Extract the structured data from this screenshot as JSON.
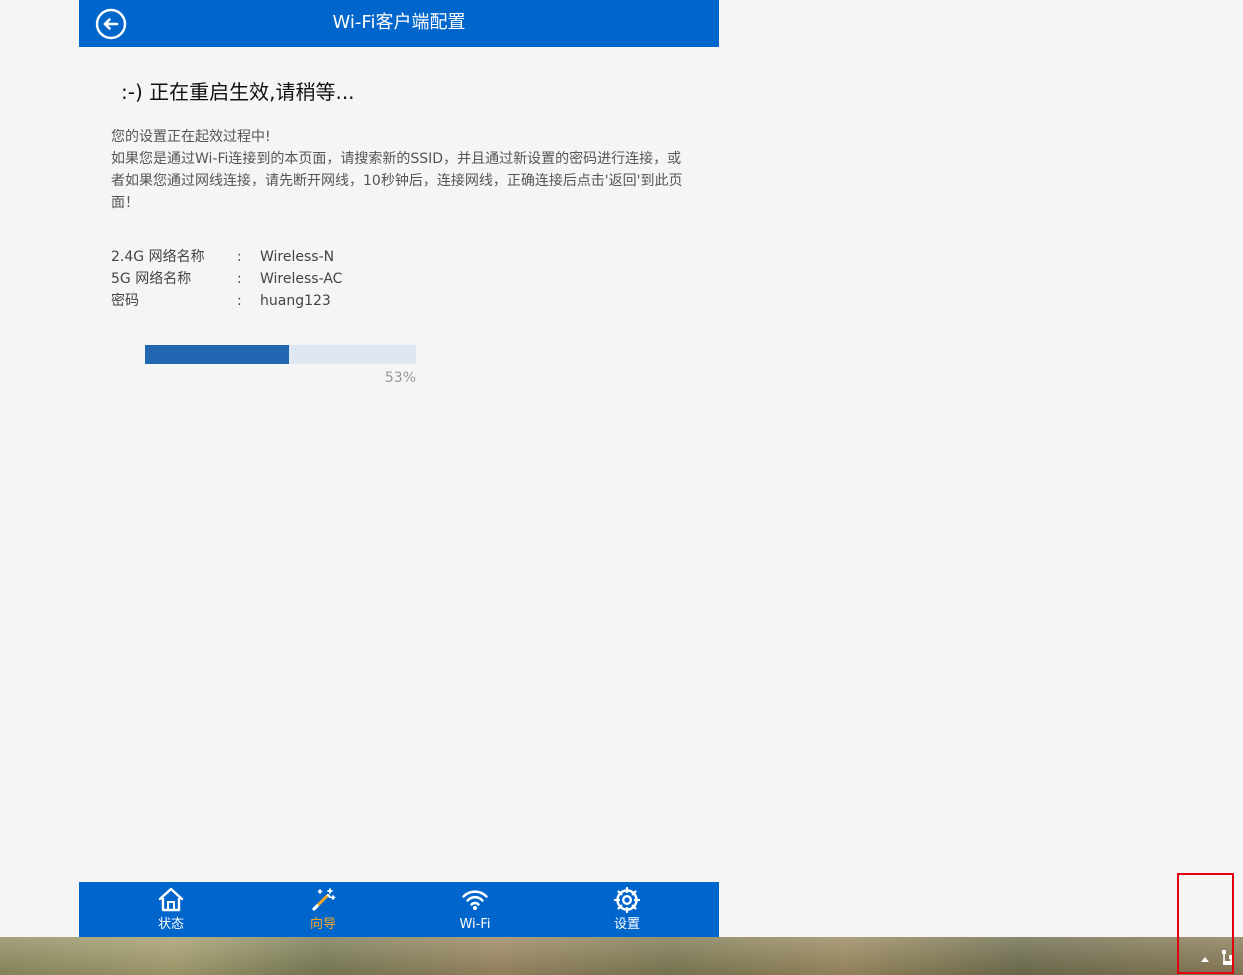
{
  "header": {
    "title": "Wi-Fi客户端配置",
    "back_icon": "arrow-left-circle-icon"
  },
  "status": {
    "heading": ":-) 正在重启生效,请稍等..."
  },
  "message": {
    "line1": "您的设置正在起效过程中!",
    "line2": "如果您是通过Wi-Fi连接到的本页面，请搜索新的SSID，并且通过新设置的密码进行连接，或者如果您通过网线连接，请先断开网线，10秒钟后，连接网线，正确连接后点击'返回'到此页面！"
  },
  "info": {
    "rows": [
      {
        "label": "2.4G 网络名称",
        "colon": ":",
        "value": "Wireless-N"
      },
      {
        "label": "5G 网络名称",
        "colon": ":",
        "value": "Wireless-AC"
      },
      {
        "label": "密码",
        "colon": ":",
        "value": "huang123"
      }
    ]
  },
  "progress": {
    "percent": 53,
    "label": "53%"
  },
  "nav": {
    "items": [
      {
        "label": "状态",
        "icon": "home-icon",
        "active": false
      },
      {
        "label": "向导",
        "icon": "magic-wand-icon",
        "active": true
      },
      {
        "label": "Wi-Fi",
        "icon": "wifi-icon",
        "active": false
      },
      {
        "label": "设置",
        "icon": "gear-icon",
        "active": false
      }
    ]
  },
  "taskbar": {
    "tray_up_icon": "up-arrow-icon",
    "network_icon": "network-icon"
  },
  "colors": {
    "header_bg": "#0066cc",
    "progress_fill": "#2166b1",
    "active_nav": "#f5a623",
    "annotation_box": "#e0000f"
  }
}
